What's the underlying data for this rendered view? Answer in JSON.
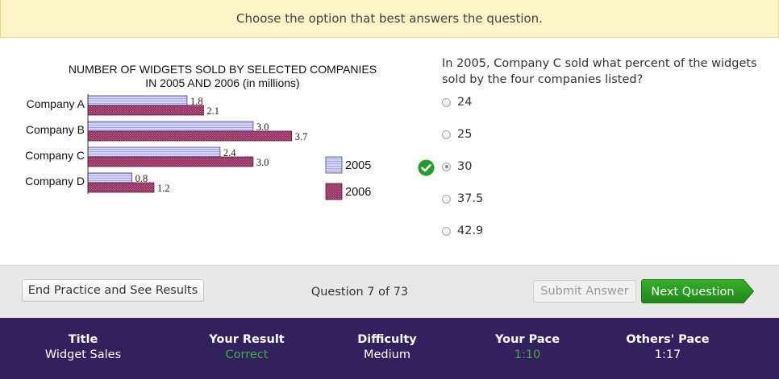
{
  "banner": {
    "text": "Choose the option that best answers the question."
  },
  "chart_data": {
    "type": "bar",
    "orientation": "horizontal",
    "title_line1": "NUMBER OF WIDGETS SOLD BY SELECTED COMPANIES",
    "title_line2": "IN 2005 AND 2006 (in millions)",
    "categories": [
      "Company A",
      "Company B",
      "Company C",
      "Company D"
    ],
    "series": [
      {
        "name": "2005",
        "values": [
          1.8,
          3.0,
          2.4,
          0.8
        ],
        "color": "#c8c8f4",
        "pattern": "horizontal-lines"
      },
      {
        "name": "2006",
        "values": [
          2.1,
          3.7,
          3.0,
          1.2
        ],
        "color": "#9a3566",
        "pattern": "dots"
      }
    ],
    "value_labels": [
      [
        "1.8",
        "2.1"
      ],
      [
        "3.0",
        "3.7"
      ],
      [
        "2.4",
        "3.0"
      ],
      [
        "0.8",
        "1.2"
      ]
    ],
    "legend_position": "right",
    "grid": false
  },
  "question": {
    "text": "In 2005, Company C sold what percent of the widgets sold by the four companies listed?",
    "options": [
      "24",
      "25",
      "30",
      "37.5",
      "42.9"
    ],
    "selected_index": 2,
    "correct_icon": "check-circle-icon"
  },
  "controls": {
    "end_label": "End Practice and See Results",
    "question_counter": "Question 7 of 73",
    "submit_label": "Submit Answer",
    "next_label": "Next Question"
  },
  "footer": {
    "title_label": "Title",
    "title_value": "Widget Sales",
    "result_label": "Your Result",
    "result_value": "Correct",
    "difficulty_label": "Difficulty",
    "difficulty_value": "Medium",
    "pace_label": "Your Pace",
    "pace_value": "1:10",
    "others_label": "Others' Pace",
    "others_value": "1:17"
  },
  "colors": {
    "footer_bg": "#33215f",
    "accent_green": "#3cb043",
    "next_button": "#2a9a1c",
    "banner_bg": "#fbf4c7"
  }
}
